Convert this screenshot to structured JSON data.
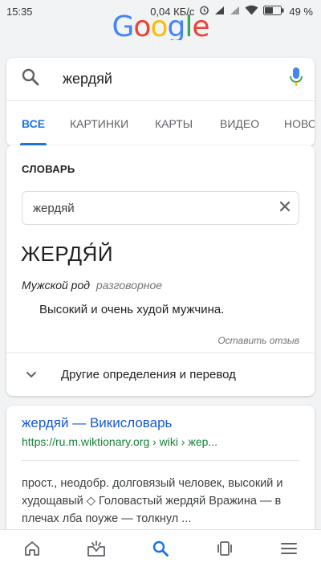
{
  "status_bar": {
    "time": "15:35",
    "network_speed": "0,04 КБ/с",
    "battery": "49 %",
    "icons": [
      "alarm-icon",
      "signal-icon",
      "signal-icon",
      "wifi-icon",
      "battery-icon"
    ]
  },
  "logo": {
    "letters": [
      "G",
      "o",
      "o",
      "g",
      "l",
      "e"
    ],
    "colors": [
      "#4285F4",
      "#EA4335",
      "#FBBC05",
      "#4285F4",
      "#34A853",
      "#EA4335"
    ]
  },
  "search": {
    "query": "жердяй",
    "icons": [
      "search-icon",
      "mic-icon"
    ]
  },
  "tabs": [
    "ВСЕ",
    "КАРТИНКИ",
    "КАРТЫ",
    "ВИДЕО",
    "НОВО"
  ],
  "active_tab": "ВСЕ",
  "dictionary": {
    "title": "СЛОВАРЬ",
    "input_value": "жердяй",
    "headword": "ЖЕРДЯ́Й",
    "part_of_speech": "Мужской род",
    "usage_tag": "разговорное",
    "definition": "Высокий и очень худой мужчина.",
    "feedback": "Оставить отзыв",
    "more_label": "Другие определения и перевод"
  },
  "result": {
    "title": "жердяй — Викисловарь",
    "url": "https://ru.m.wiktionary.org › wiki › жер...",
    "snippet": "прост., неодобр. долговязый человек, высокий и худощавый ◇ Головастый жердяй Вражина — в плечах лба поуже — толкнул ..."
  },
  "bottom_nav": [
    "home-icon",
    "updates-icon",
    "search-icon",
    "tabs-icon",
    "menu-icon"
  ],
  "accent_color": "#1a73e8"
}
